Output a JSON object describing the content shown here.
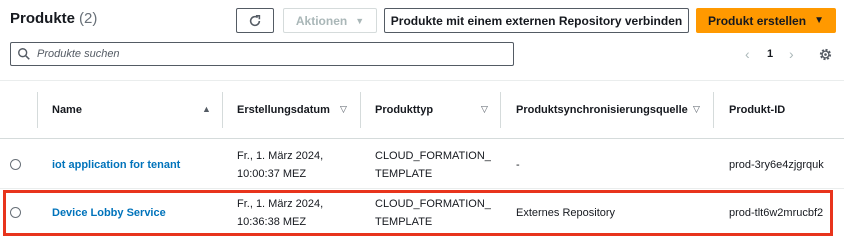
{
  "header": {
    "title": "Produkte",
    "count": "(2)",
    "refresh_icon": "refresh-icon",
    "actions_label": "Aktionen",
    "connect_label": "Produkte mit einem externen Repository verbinden",
    "create_label": "Produkt erstellen"
  },
  "search": {
    "placeholder": "Produkte suchen",
    "value": "",
    "icon": "search-icon"
  },
  "pagination": {
    "prev_icon": "chevron-left-icon",
    "current_page": "1",
    "next_icon": "chevron-right-icon",
    "settings_icon": "gear-icon"
  },
  "table": {
    "columns": [
      "Name",
      "Erstellungsdatum",
      "Produkttyp",
      "Produktsynchronisierungsquelle",
      "Produkt-ID"
    ],
    "rows": [
      {
        "name": "iot application for tenant",
        "date_line1": "Fr., 1. März 2024,",
        "date_line2": "10:00:37 MEZ",
        "type_line1": "CLOUD_FORMATION_",
        "type_line2": "TEMPLATE",
        "source": "-",
        "id": "prod-3ry6e4zjgrquk",
        "highlighted": false
      },
      {
        "name": "Device Lobby Service",
        "date_line1": "Fr., 1. März 2024,",
        "date_line2": "10:36:38 MEZ",
        "type_line1": "CLOUD_FORMATION_",
        "type_line2": "TEMPLATE",
        "source": "Externes Repository",
        "id": "prod-tlt6w2mrucbf2",
        "highlighted": true
      }
    ]
  },
  "colors": {
    "accent_orange": "#ff9900",
    "link_blue": "#0073bb",
    "highlight_red": "#e8341c",
    "text_dark": "#16191f"
  }
}
